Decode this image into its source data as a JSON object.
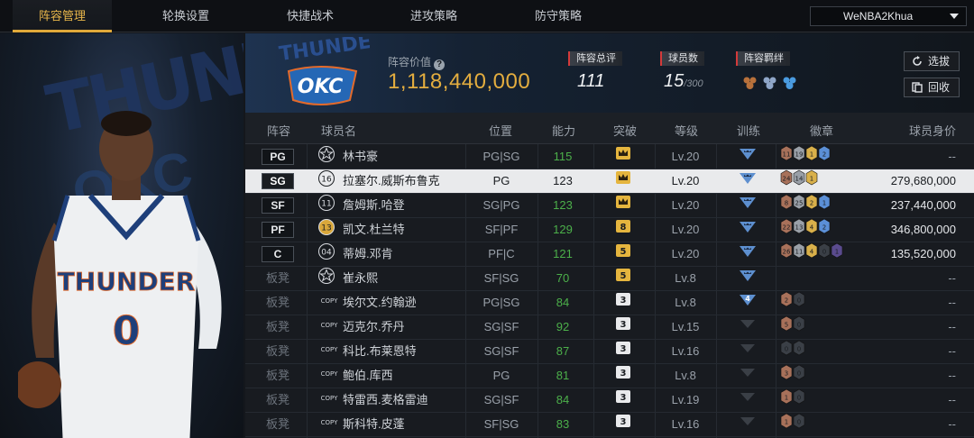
{
  "nav": {
    "tabs": [
      "阵容管理",
      "轮换设置",
      "快捷战术",
      "进攻策略",
      "防守策略"
    ],
    "active_index": 0,
    "account": "WeNBA2Khua"
  },
  "team": {
    "value_label": "阵容价值",
    "value": "1,118,440,000",
    "overall_label": "阵容总评",
    "overall": "111",
    "players_label": "球员数",
    "players": "15",
    "players_max": "/300",
    "bond_label": "阵容羁绊",
    "pick_button": "选拔",
    "recycle_button": "回收"
  },
  "table": {
    "headers": [
      "阵容",
      "球员名",
      "位置",
      "能力",
      "突破",
      "等级",
      "训练",
      "徽章",
      "球员身价"
    ],
    "rows": [
      {
        "slot": "PG",
        "starter": true,
        "icon": "star",
        "name": "林书豪",
        "pos": "PG|SG",
        "ability": "115",
        "green": true,
        "breakthrough": "crown",
        "level": "Lv.20",
        "training": "crown",
        "badges": [
          "11",
          "19",
          "1",
          "2"
        ],
        "price": "--"
      },
      {
        "slot": "SG",
        "starter": true,
        "icon": "16",
        "name": "拉塞尔.威斯布鲁克",
        "pos": "PG",
        "ability": "123",
        "green": false,
        "breakthrough": "crown",
        "level": "Lv.20",
        "training": "crown",
        "badges": [
          "24",
          "14",
          "1"
        ],
        "price": "279,680,000",
        "selected": true
      },
      {
        "slot": "SF",
        "starter": true,
        "icon": "11",
        "name": "詹姆斯.哈登",
        "pos": "SG|PG",
        "ability": "123",
        "green": true,
        "breakthrough": "crown",
        "level": "Lv.20",
        "training": "crown",
        "badges": [
          "8",
          "25",
          "2",
          "1"
        ],
        "price": "237,440,000"
      },
      {
        "slot": "PF",
        "starter": true,
        "icon": "13",
        "name": "凯文.杜兰特",
        "pos": "SF|PF",
        "ability": "129",
        "green": true,
        "breakthrough": "8",
        "level": "Lv.20",
        "training": "crown",
        "badges": [
          "22",
          "13",
          "4",
          "2"
        ],
        "price": "346,800,000"
      },
      {
        "slot": "C",
        "starter": true,
        "icon": "04",
        "name": "蒂姆.邓肯",
        "pos": "PF|C",
        "ability": "121",
        "green": true,
        "breakthrough": "5",
        "level": "Lv.20",
        "training": "crown",
        "badges": [
          "26",
          "11",
          "4",
          "0",
          "1"
        ],
        "price": "135,520,000"
      },
      {
        "slot": "板凳",
        "starter": false,
        "icon": "star",
        "name": "崔永熙",
        "pos": "SF|SG",
        "ability": "70",
        "green": true,
        "breakthrough": "5",
        "level": "Lv.8",
        "training": "crown",
        "badges": [],
        "price": "--"
      },
      {
        "slot": "板凳",
        "starter": false,
        "icon": "COPY",
        "name": "埃尔文.约翰逊",
        "pos": "PG|SG",
        "ability": "84",
        "green": true,
        "breakthrough": "3",
        "level": "Lv.8",
        "training": "4",
        "badges": [
          "2",
          "0"
        ],
        "price": "--"
      },
      {
        "slot": "板凳",
        "starter": false,
        "icon": "COPY",
        "name": "迈克尔.乔丹",
        "pos": "SG|SF",
        "ability": "92",
        "green": true,
        "breakthrough": "3",
        "level": "Lv.15",
        "training": "none",
        "badges": [
          "5",
          "0"
        ],
        "price": "--"
      },
      {
        "slot": "板凳",
        "starter": false,
        "icon": "COPY",
        "name": "科比.布莱恩特",
        "pos": "SG|SF",
        "ability": "87",
        "green": true,
        "breakthrough": "3",
        "level": "Lv.16",
        "training": "none",
        "badges": [
          "0",
          "0"
        ],
        "price": "--"
      },
      {
        "slot": "板凳",
        "starter": false,
        "icon": "COPY",
        "name": "鲍伯.库西",
        "pos": "PG",
        "ability": "81",
        "green": true,
        "breakthrough": "3",
        "level": "Lv.8",
        "training": "none",
        "badges": [
          "3",
          "0"
        ],
        "price": "--"
      },
      {
        "slot": "板凳",
        "starter": false,
        "icon": "COPY",
        "name": "特雷西.麦格雷迪",
        "pos": "SG|SF",
        "ability": "84",
        "green": true,
        "breakthrough": "3",
        "level": "Lv.19",
        "training": "none",
        "badges": [
          "1",
          "0"
        ],
        "price": "--"
      },
      {
        "slot": "板凳",
        "starter": false,
        "icon": "COPY",
        "name": "斯科特.皮蓬",
        "pos": "SF|SG",
        "ability": "83",
        "green": true,
        "breakthrough": "3",
        "level": "Lv.16",
        "training": "none",
        "badges": [
          "1",
          "0"
        ],
        "price": "--"
      }
    ]
  },
  "colors": {
    "accent_gold": "#e3ad3f",
    "ability_green": "#4cb04a",
    "tag_red": "#d43a3a"
  }
}
